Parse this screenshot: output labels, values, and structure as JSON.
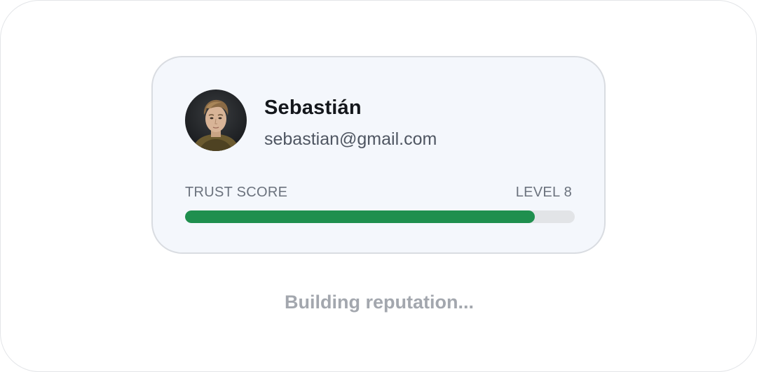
{
  "profile": {
    "name": "Sebastián",
    "email": "sebastian@gmail.com",
    "avatar_icon": "user-portrait"
  },
  "trust": {
    "label": "TRUST SCORE",
    "level_label": "LEVEL 8",
    "progress_fraction": 0.897,
    "fill_color": "#1f8f4e",
    "track_color": "#e2e4e7"
  },
  "status": {
    "text": "Building reputation..."
  }
}
